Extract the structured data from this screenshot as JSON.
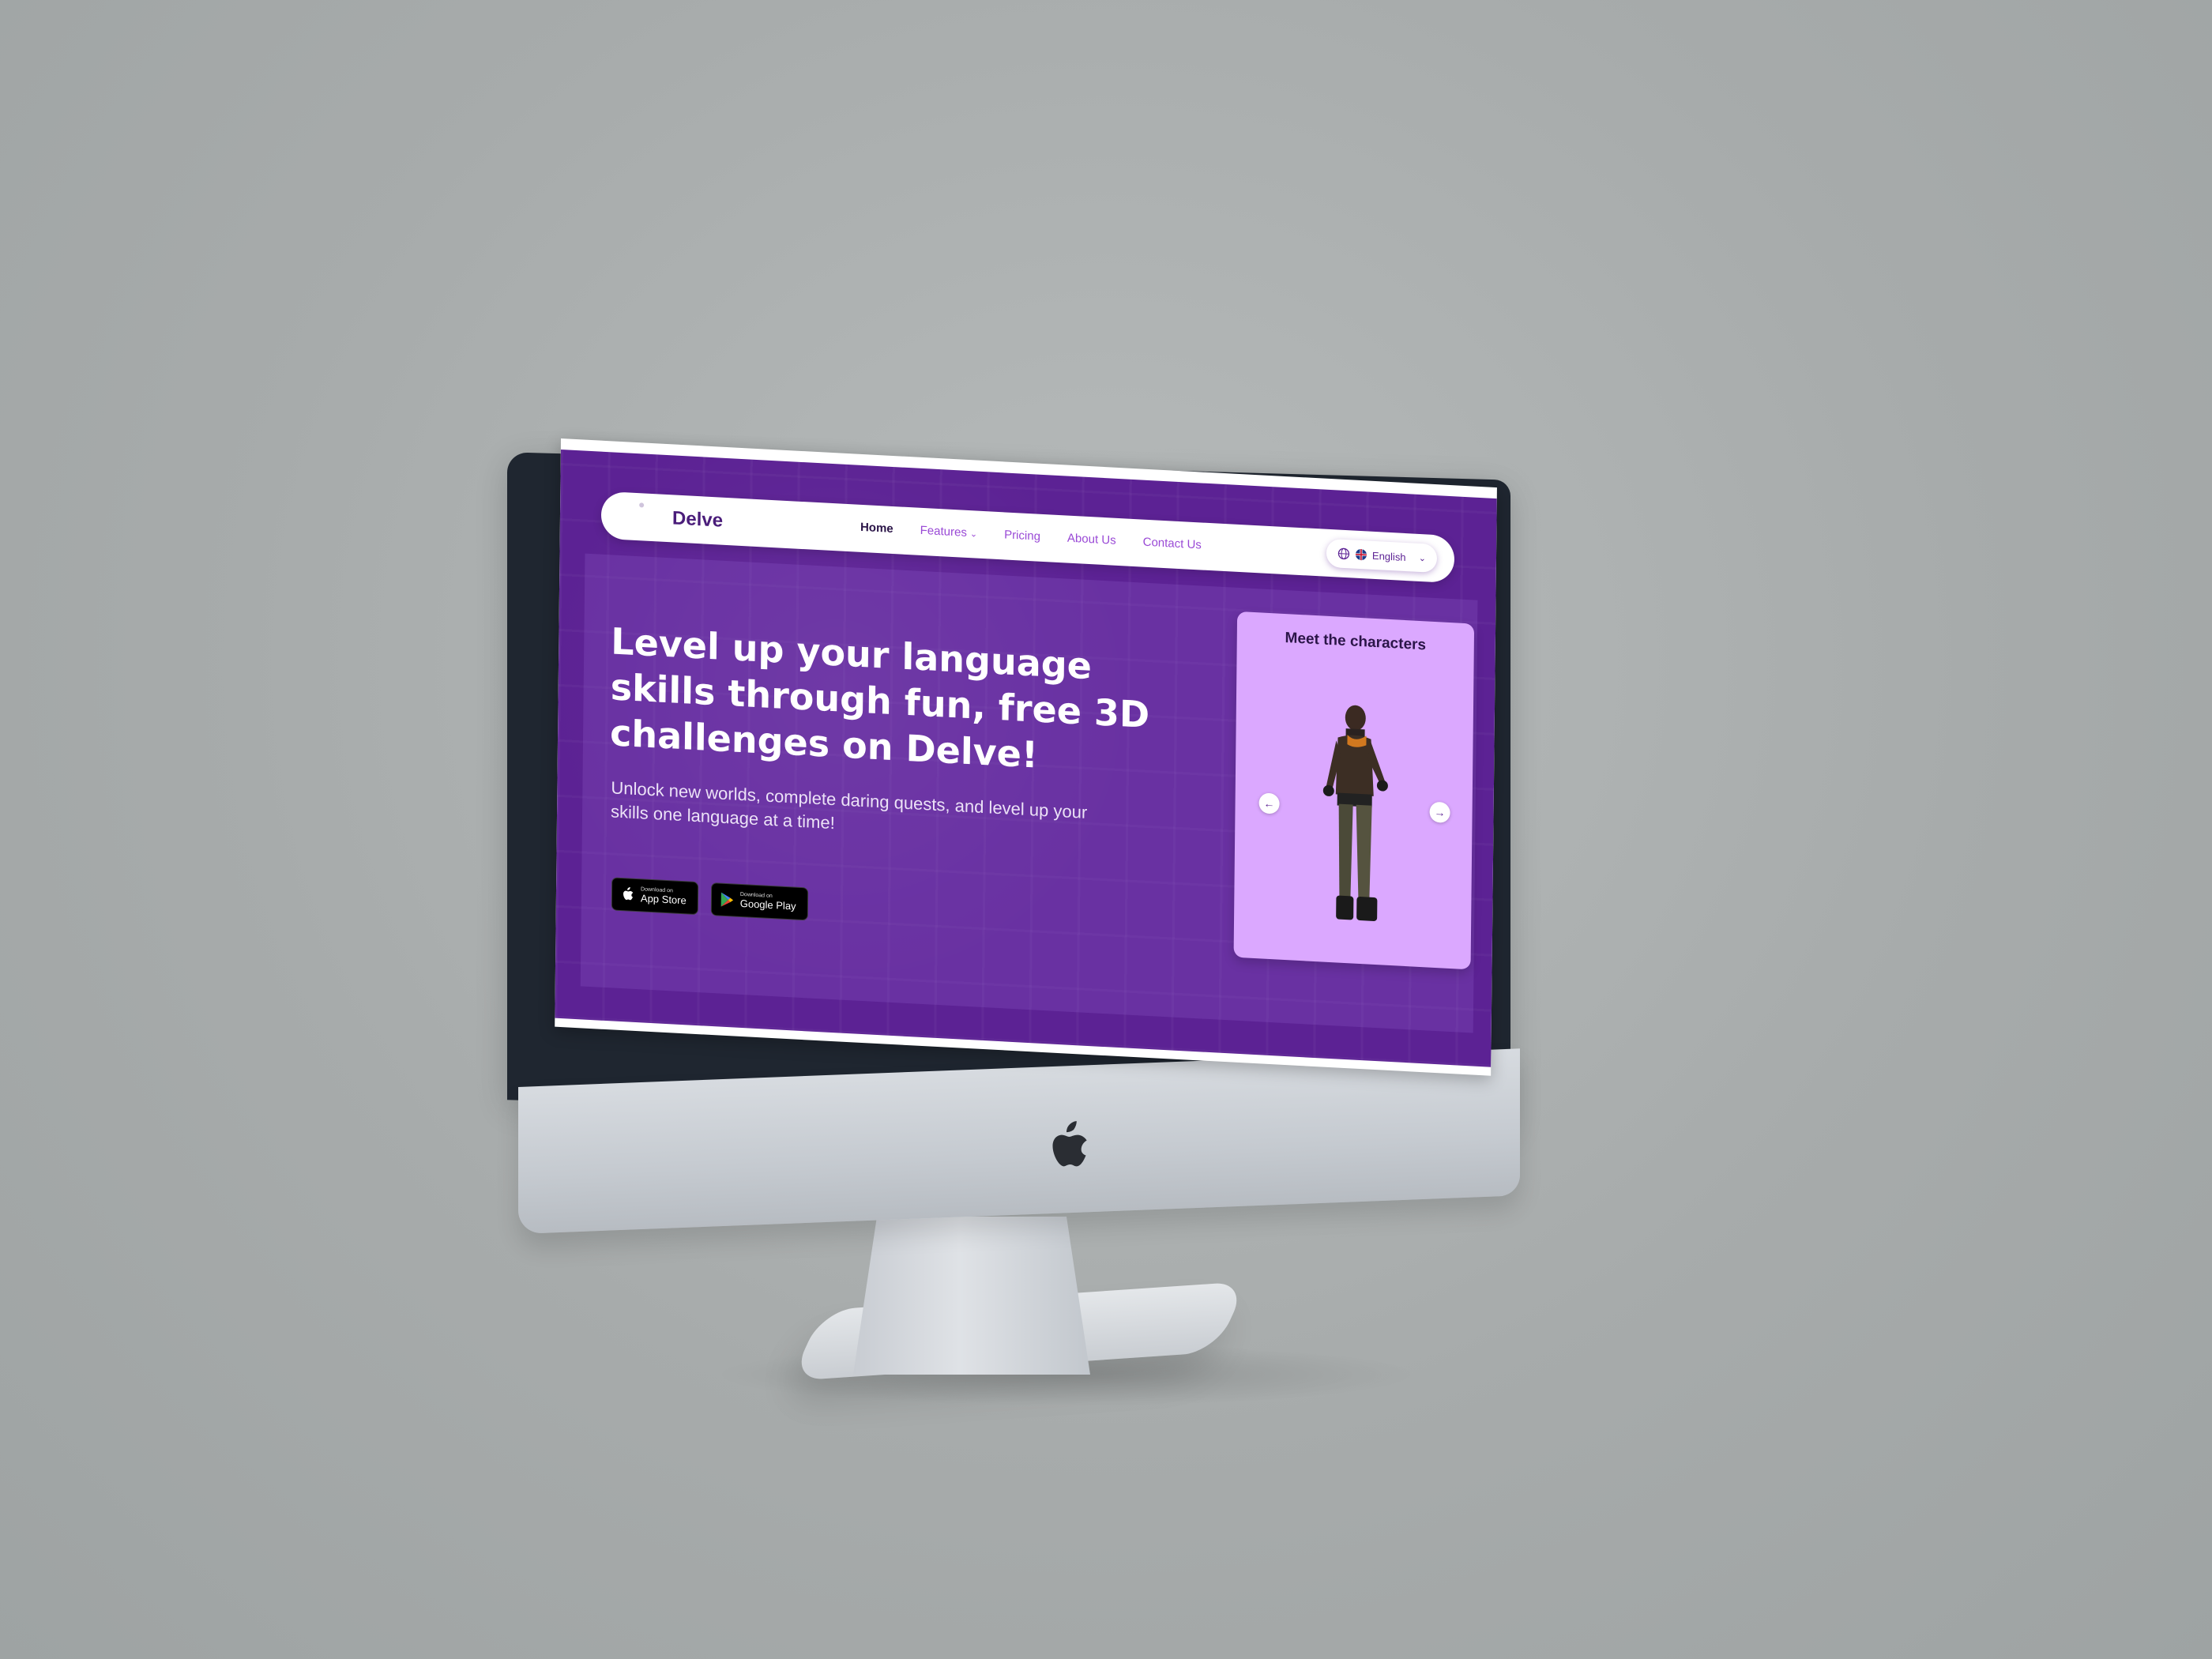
{
  "site": {
    "brand": "Delve",
    "nav": [
      {
        "label": "Home",
        "active": true
      },
      {
        "label": "Features",
        "dropdown": true
      },
      {
        "label": "Pricing"
      },
      {
        "label": "About Us"
      },
      {
        "label": "Contact Us"
      }
    ],
    "language": {
      "selected": "English",
      "icons": [
        "globe-icon",
        "uk-flag-icon",
        "chevron-down-icon"
      ]
    },
    "hero": {
      "title": "Level up your language skills through fun, free 3D challenges on Delve!",
      "subtitle": "Unlock new worlds, complete daring quests, and level up your skills one language at a time!"
    },
    "stores": [
      {
        "small": "Download on",
        "big": "App Store",
        "icon": "apple-icon"
      },
      {
        "small": "Download on",
        "big": "Google Play",
        "icon": "google-play-icon"
      }
    ],
    "characters": {
      "title": "Meet the characters",
      "prev_icon": "arrow-left-icon",
      "next_icon": "arrow-right-icon"
    }
  },
  "colors": {
    "primary": "#5c2294",
    "card": "#dba8ff",
    "text_dark": "#2b1548",
    "nav_link": "#9a4ad6"
  }
}
